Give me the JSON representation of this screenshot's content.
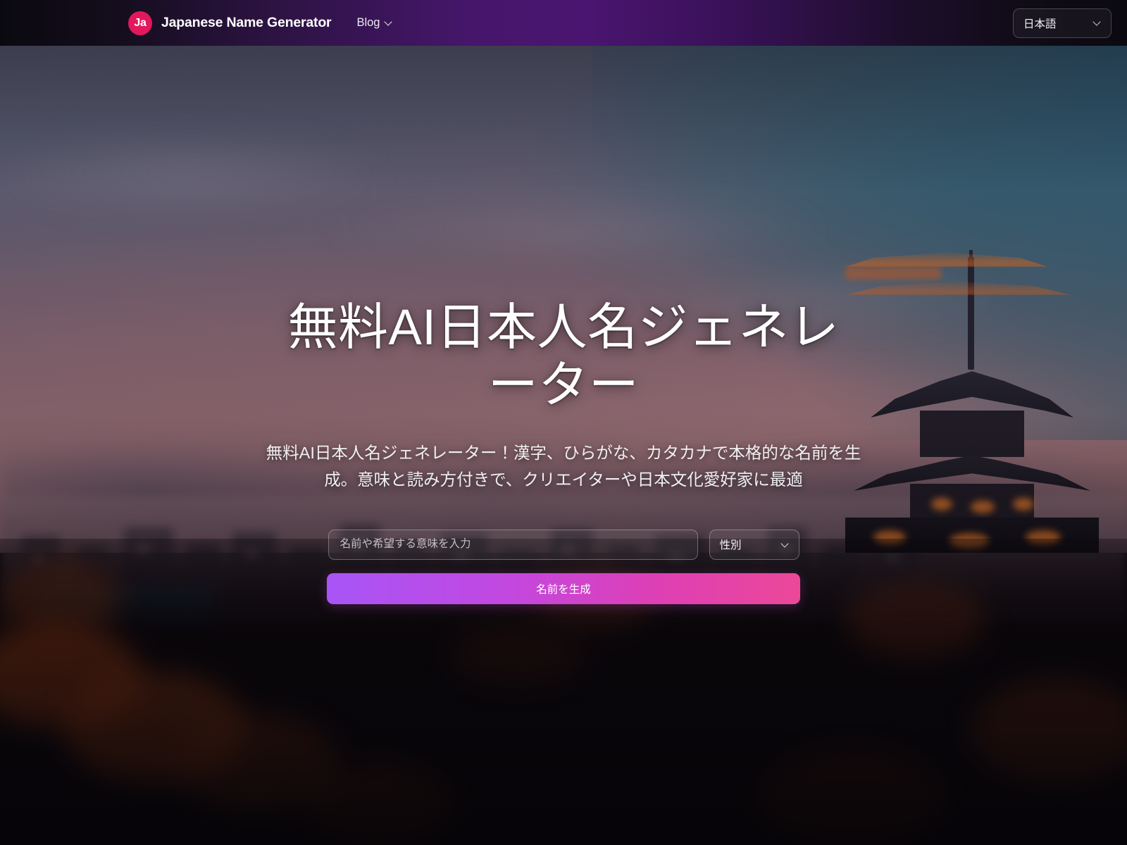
{
  "navbar": {
    "logo_text": "Ja",
    "brand_name": "Japanese Name Generator",
    "links": [
      {
        "label": "Blog",
        "icon": "chevron-down-icon"
      }
    ],
    "language_selector": {
      "value": "日本語",
      "icon": "chevron-down-icon"
    },
    "colors": {
      "gradient_dark": "#0b0910",
      "gradient_purple": "#4a1570",
      "logo_pink": "#e3185c"
    }
  },
  "hero": {
    "title": "無料AI日本人名ジェネレーター",
    "subtitle": "無料AI日本人名ジェネレーター！漢字、ひらがな、カタカナで本格的な名前を生成。意味と読み方付きで、クリエイターや日本文化愛好家に最適",
    "form": {
      "name_input": {
        "placeholder": "名前や希望する意味を入力",
        "value": ""
      },
      "gender_select": {
        "value": "性別",
        "icon": "chevron-down-icon"
      },
      "generate_button": {
        "label": "名前を生成",
        "gradient_start": "#a855f7",
        "gradient_end": "#ec4899"
      }
    },
    "background": {
      "description": "blurred dusk photo of a Japanese pagoda over a city skyline with autumn foliage",
      "sky_color": "#5c6076",
      "accent_color": "#a4787f"
    }
  }
}
